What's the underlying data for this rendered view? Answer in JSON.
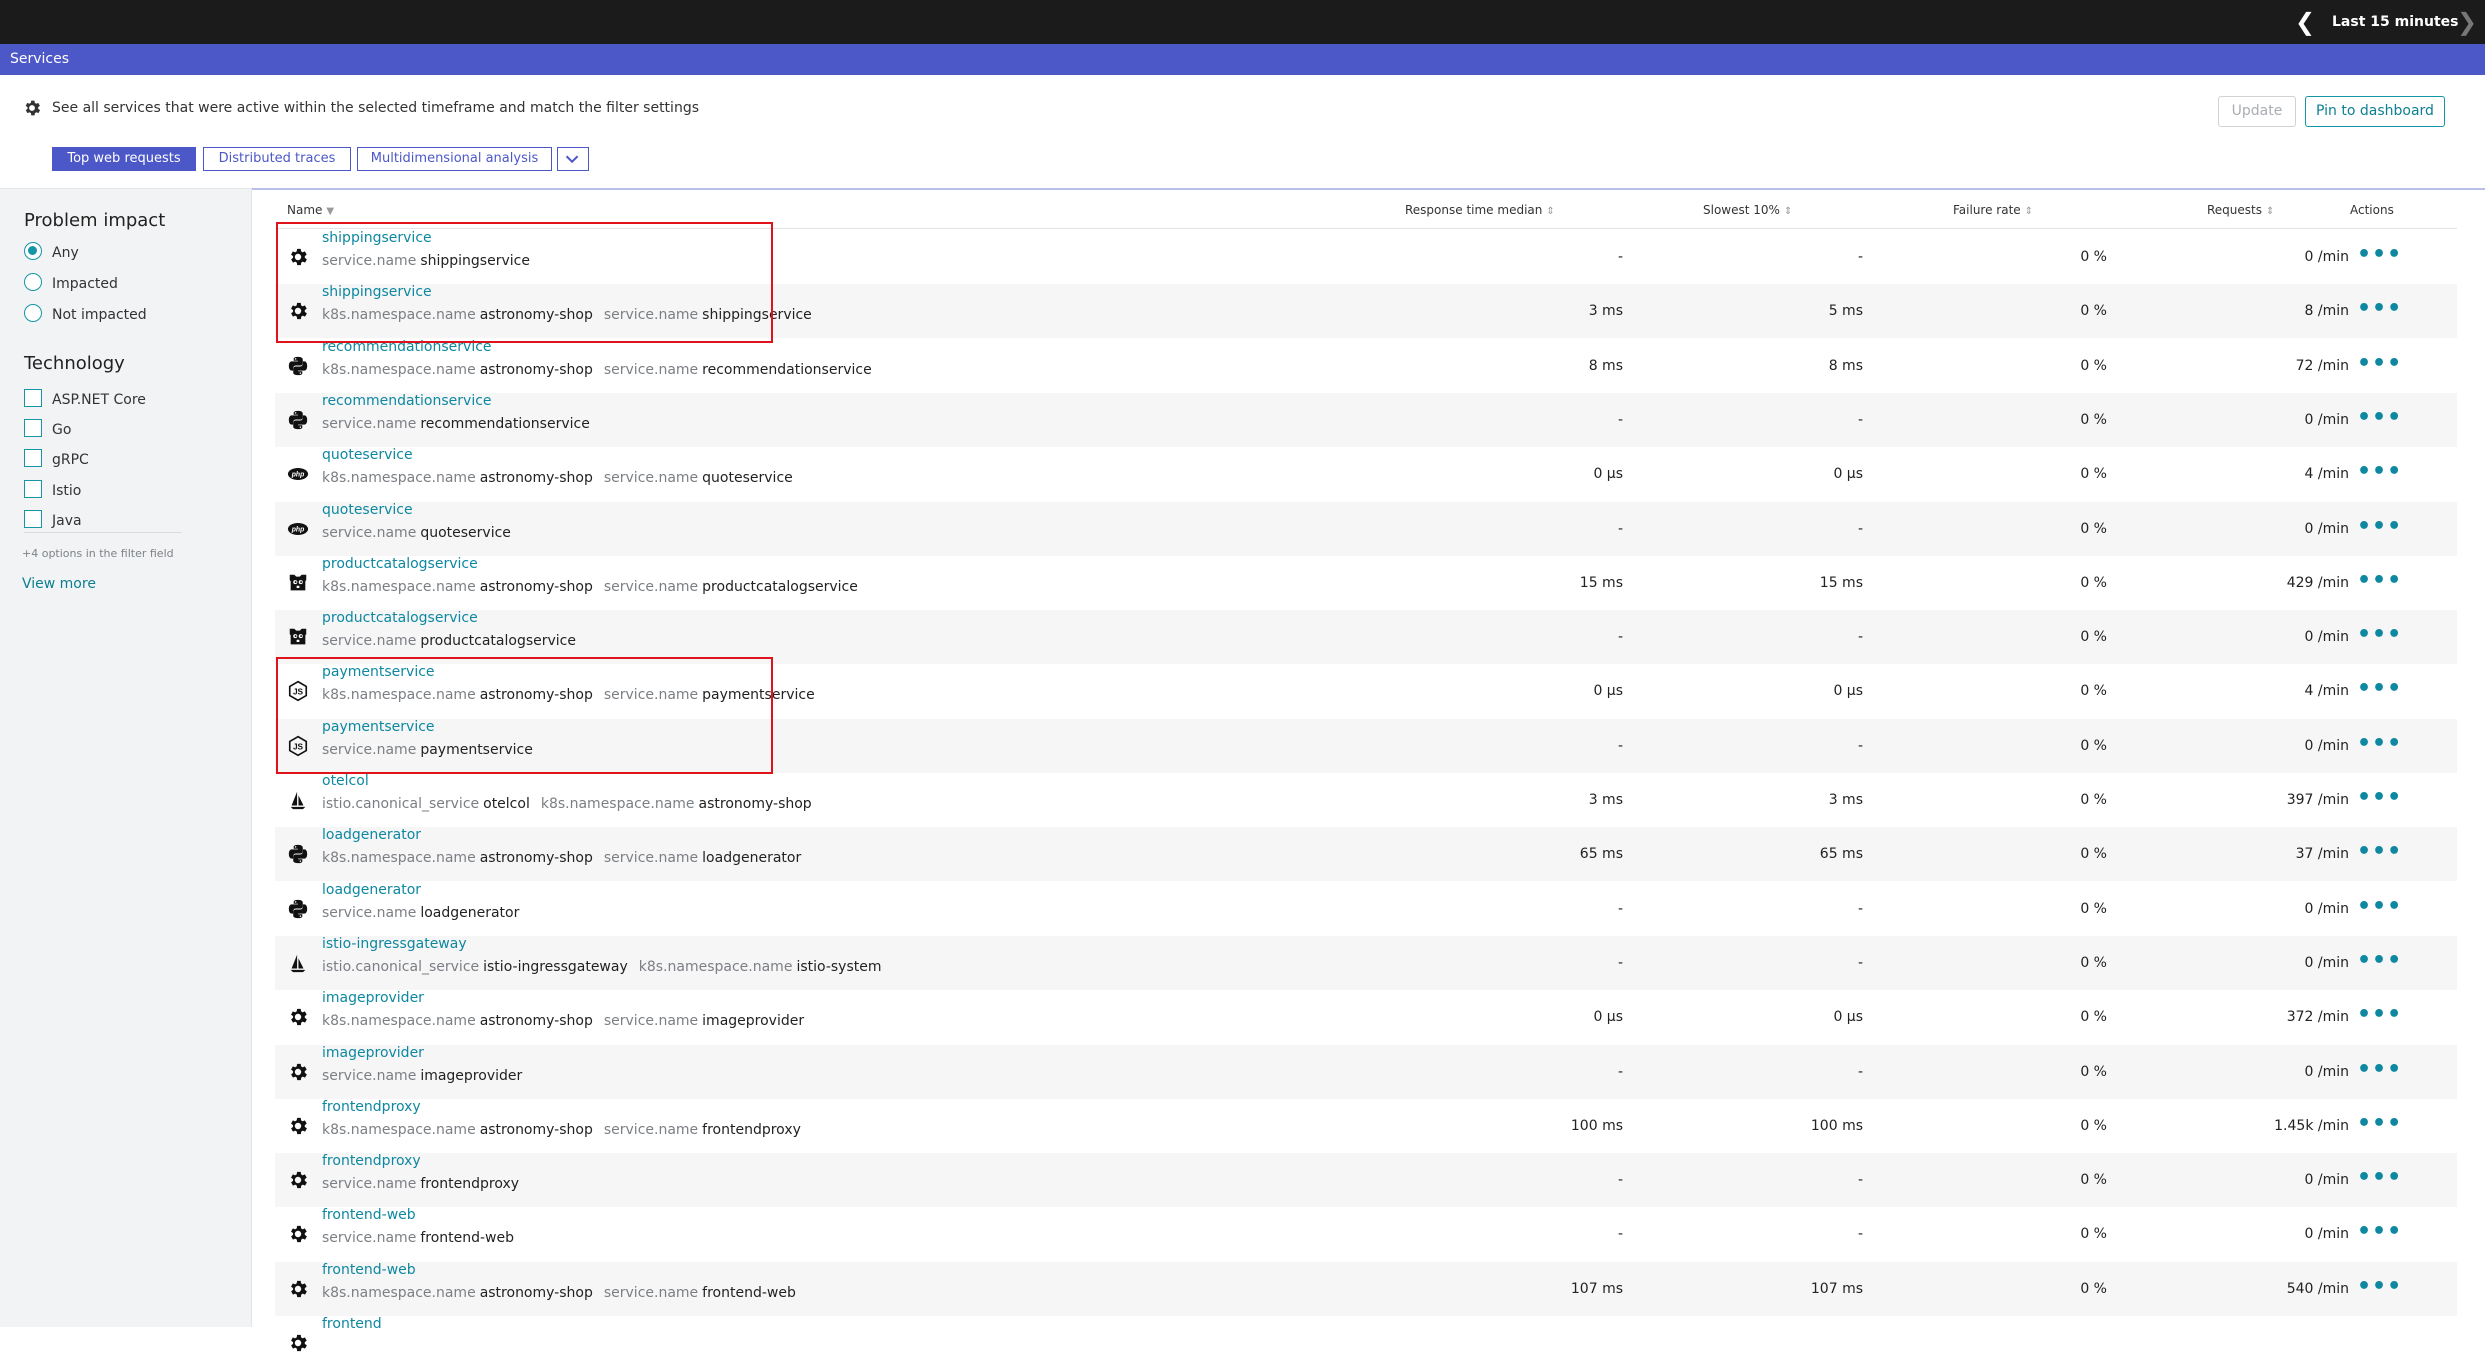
{
  "topbar": {
    "timeframe_label": "Last 15 minutes",
    "prev_glyph": "❮",
    "next_glyph": "❯"
  },
  "page": {
    "title": "Services"
  },
  "header": {
    "description": "See all services that were active within the selected timeframe and match the filter settings",
    "update_label": "Update",
    "pin_label": "Pin to dashboard",
    "tabs": [
      {
        "label": "Top web requests",
        "active": true
      },
      {
        "label": "Distributed traces",
        "active": false
      },
      {
        "label": "Multidimensional analysis",
        "active": false
      }
    ]
  },
  "sidebar": {
    "problem_impact": {
      "title": "Problem impact",
      "options": [
        {
          "label": "Any",
          "selected": true
        },
        {
          "label": "Impacted",
          "selected": false
        },
        {
          "label": "Not impacted",
          "selected": false
        }
      ]
    },
    "technology": {
      "title": "Technology",
      "options": [
        {
          "label": "ASP.NET Core"
        },
        {
          "label": "Go"
        },
        {
          "label": "gRPC"
        },
        {
          "label": "Istio"
        },
        {
          "label": "Java"
        }
      ],
      "note": "+4 options in the filter field",
      "view_more": "View more"
    }
  },
  "table": {
    "columns": {
      "name": "Name",
      "response_time": "Response time median",
      "slowest": "Slowest 10%",
      "failure_rate": "Failure rate",
      "requests": "Requests",
      "actions": "Actions"
    },
    "action_glyph": "•••",
    "rows": [
      {
        "name": "shippingservice",
        "icon": "gear",
        "tags": [
          [
            "service.name",
            "shippingservice"
          ]
        ],
        "rt": "-",
        "slow": "-",
        "fail": "0 %",
        "req": "0 /min"
      },
      {
        "name": "shippingservice",
        "icon": "gear",
        "tags": [
          [
            "k8s.namespace.name",
            "astronomy-shop"
          ],
          [
            "service.name",
            "shippingservice"
          ]
        ],
        "rt": "3 ms",
        "slow": "5 ms",
        "fail": "0 %",
        "req": "8 /min"
      },
      {
        "name": "recommendationservice",
        "icon": "python",
        "tags": [
          [
            "k8s.namespace.name",
            "astronomy-shop"
          ],
          [
            "service.name",
            "recommendationservice"
          ]
        ],
        "rt": "8 ms",
        "slow": "8 ms",
        "fail": "0 %",
        "req": "72 /min"
      },
      {
        "name": "recommendationservice",
        "icon": "python",
        "tags": [
          [
            "service.name",
            "recommendationservice"
          ]
        ],
        "rt": "-",
        "slow": "-",
        "fail": "0 %",
        "req": "0 /min"
      },
      {
        "name": "quoteservice",
        "icon": "php",
        "tags": [
          [
            "k8s.namespace.name",
            "astronomy-shop"
          ],
          [
            "service.name",
            "quoteservice"
          ]
        ],
        "rt": "0 µs",
        "slow": "0 µs",
        "fail": "0 %",
        "req": "4 /min"
      },
      {
        "name": "quoteservice",
        "icon": "php",
        "tags": [
          [
            "service.name",
            "quoteservice"
          ]
        ],
        "rt": "-",
        "slow": "-",
        "fail": "0 %",
        "req": "0 /min"
      },
      {
        "name": "productcatalogservice",
        "icon": "gopher",
        "tags": [
          [
            "k8s.namespace.name",
            "astronomy-shop"
          ],
          [
            "service.name",
            "productcatalogservice"
          ]
        ],
        "rt": "15 ms",
        "slow": "15 ms",
        "fail": "0 %",
        "req": "429 /min"
      },
      {
        "name": "productcatalogservice",
        "icon": "gopher",
        "tags": [
          [
            "service.name",
            "productcatalogservice"
          ]
        ],
        "rt": "-",
        "slow": "-",
        "fail": "0 %",
        "req": "0 /min"
      },
      {
        "name": "paymentservice",
        "icon": "nodejs",
        "tags": [
          [
            "k8s.namespace.name",
            "astronomy-shop"
          ],
          [
            "service.name",
            "paymentservice"
          ]
        ],
        "rt": "0 µs",
        "slow": "0 µs",
        "fail": "0 %",
        "req": "4 /min"
      },
      {
        "name": "paymentservice",
        "icon": "nodejs",
        "tags": [
          [
            "service.name",
            "paymentservice"
          ]
        ],
        "rt": "-",
        "slow": "-",
        "fail": "0 %",
        "req": "0 /min"
      },
      {
        "name": "otelcol",
        "icon": "istio",
        "tags": [
          [
            "istio.canonical_service",
            "otelcol"
          ],
          [
            "k8s.namespace.name",
            "astronomy-shop"
          ]
        ],
        "rt": "3 ms",
        "slow": "3 ms",
        "fail": "0 %",
        "req": "397 /min"
      },
      {
        "name": "loadgenerator",
        "icon": "python",
        "tags": [
          [
            "k8s.namespace.name",
            "astronomy-shop"
          ],
          [
            "service.name",
            "loadgenerator"
          ]
        ],
        "rt": "65 ms",
        "slow": "65 ms",
        "fail": "0 %",
        "req": "37 /min"
      },
      {
        "name": "loadgenerator",
        "icon": "python",
        "tags": [
          [
            "service.name",
            "loadgenerator"
          ]
        ],
        "rt": "-",
        "slow": "-",
        "fail": "0 %",
        "req": "0 /min"
      },
      {
        "name": "istio-ingressgateway",
        "icon": "istio",
        "tags": [
          [
            "istio.canonical_service",
            "istio-ingressgateway"
          ],
          [
            "k8s.namespace.name",
            "istio-system"
          ]
        ],
        "rt": "-",
        "slow": "-",
        "fail": "0 %",
        "req": "0 /min"
      },
      {
        "name": "imageprovider",
        "icon": "gear",
        "tags": [
          [
            "k8s.namespace.name",
            "astronomy-shop"
          ],
          [
            "service.name",
            "imageprovider"
          ]
        ],
        "rt": "0 µs",
        "slow": "0 µs",
        "fail": "0 %",
        "req": "372 /min"
      },
      {
        "name": "imageprovider",
        "icon": "gear",
        "tags": [
          [
            "service.name",
            "imageprovider"
          ]
        ],
        "rt": "-",
        "slow": "-",
        "fail": "0 %",
        "req": "0 /min"
      },
      {
        "name": "frontendproxy",
        "icon": "gear",
        "tags": [
          [
            "k8s.namespace.name",
            "astronomy-shop"
          ],
          [
            "service.name",
            "frontendproxy"
          ]
        ],
        "rt": "100 ms",
        "slow": "100 ms",
        "fail": "0 %",
        "req": "1.45k /min"
      },
      {
        "name": "frontendproxy",
        "icon": "gear",
        "tags": [
          [
            "service.name",
            "frontendproxy"
          ]
        ],
        "rt": "-",
        "slow": "-",
        "fail": "0 %",
        "req": "0 /min"
      },
      {
        "name": "frontend-web",
        "icon": "gear",
        "tags": [
          [
            "service.name",
            "frontend-web"
          ]
        ],
        "rt": "-",
        "slow": "-",
        "fail": "0 %",
        "req": "0 /min"
      },
      {
        "name": "frontend-web",
        "icon": "gear",
        "tags": [
          [
            "k8s.namespace.name",
            "astronomy-shop"
          ],
          [
            "service.name",
            "frontend-web"
          ]
        ],
        "rt": "107 ms",
        "slow": "107 ms",
        "fail": "0 %",
        "req": "540 /min"
      },
      {
        "name": "frontend",
        "icon": "gear",
        "tags": [],
        "rt": "",
        "slow": "",
        "fail": "",
        "req": ""
      }
    ]
  },
  "colors": {
    "accent": "#4c57c8",
    "link": "#0d88a0",
    "highlight": "#e0121b"
  }
}
